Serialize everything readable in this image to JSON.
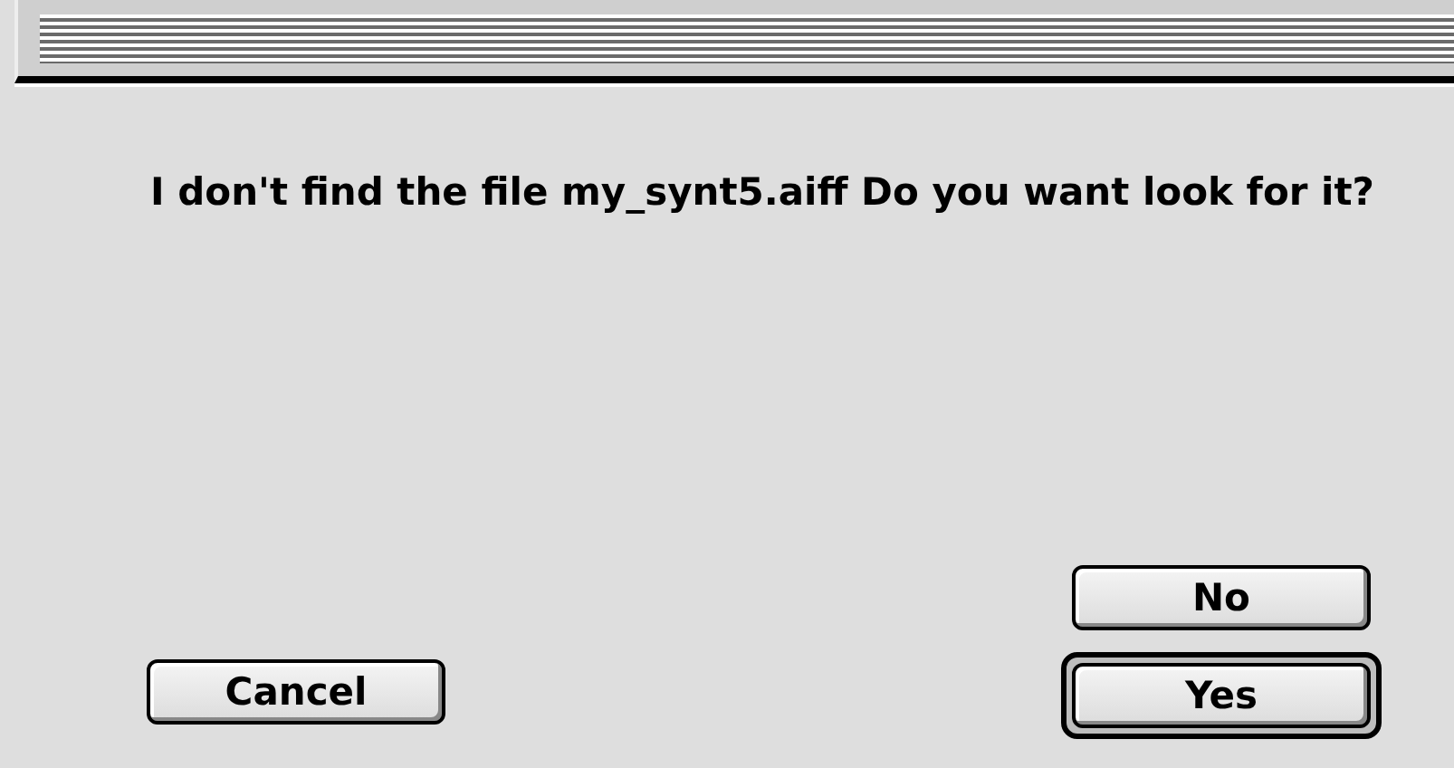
{
  "message": "I don't find the file my_synt5.aiff Do you want look for it?",
  "buttons": [
    {
      "label": "No",
      "kind": "alternate",
      "default": false
    },
    {
      "label": "Cancel",
      "kind": "cancel",
      "default": false
    },
    {
      "label": "Yes",
      "kind": "confirm",
      "default": true
    }
  ]
}
